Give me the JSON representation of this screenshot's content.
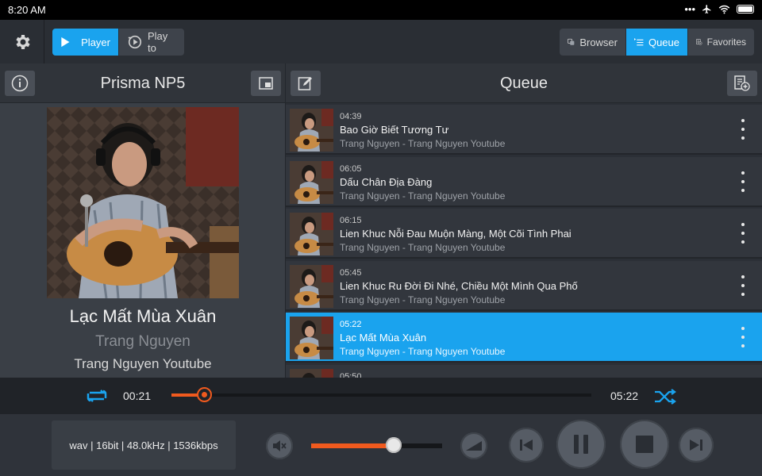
{
  "status_bar": {
    "time": "8:20 AM",
    "signal": "•••"
  },
  "topbar": {
    "player_tab": "Player",
    "playto_tab": "Play to",
    "browser_tab": "Browser",
    "queue_tab": "Queue",
    "favorites_tab": "Favorites"
  },
  "left_panel": {
    "device_name": "Prisma NP5",
    "track_title": "Lạc Mất Mùa Xuân",
    "artist": "Trang Nguyen",
    "album": "Trang Nguyen Youtube"
  },
  "queue_panel": {
    "title": "Queue",
    "items": [
      {
        "duration": "04:39",
        "title": "Bao Giờ Biết Tương Tư",
        "subtitle": "Trang Nguyen - Trang Nguyen Youtube",
        "active": false
      },
      {
        "duration": "06:05",
        "title": "Dấu Chân Địa Đàng",
        "subtitle": "Trang Nguyen - Trang Nguyen Youtube",
        "active": false
      },
      {
        "duration": "06:15",
        "title": "Lien Khuc Nỗi Đau Muộn Màng, Một Cõi Tình Phai",
        "subtitle": "Trang Nguyen - Trang Nguyen Youtube",
        "active": false
      },
      {
        "duration": "05:45",
        "title": "Lien Khuc Ru Đời Đi Nhé, Chiều Một Mình Qua Phố",
        "subtitle": "Trang Nguyen - Trang Nguyen Youtube",
        "active": false
      },
      {
        "duration": "05:22",
        "title": "Lạc Mất Mùa Xuân",
        "subtitle": "Trang Nguyen - Trang Nguyen Youtube",
        "active": true
      },
      {
        "duration": "05:50",
        "title": "",
        "subtitle": "",
        "active": false
      }
    ]
  },
  "playback": {
    "elapsed": "00:21",
    "total": "05:22",
    "progress_fraction": 0.065,
    "volume_fraction": 0.58
  },
  "format_info": "wav | 16bit | 48.0kHz | 1536kbps",
  "colors": {
    "accent": "#1aa3ee",
    "progress": "#f05a1e"
  },
  "icons": [
    "gear-icon",
    "play-icon",
    "play-to-icon",
    "browser-icon",
    "queue-icon",
    "favorites-icon",
    "info-icon",
    "window-icon",
    "edit-icon",
    "add-to-playlist-icon",
    "repeat-icon",
    "shuffle-icon",
    "mute-icon",
    "volume-icon",
    "previous-icon",
    "pause-icon",
    "stop-icon",
    "next-icon"
  ]
}
